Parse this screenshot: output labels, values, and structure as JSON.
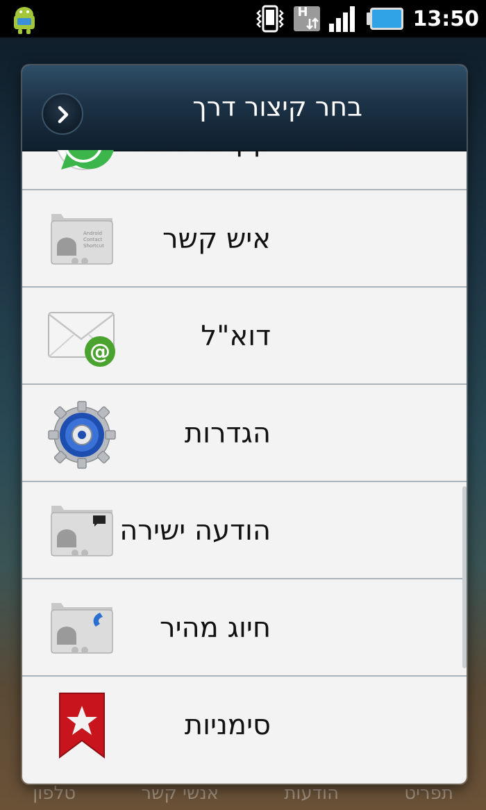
{
  "status_bar": {
    "time": "13:50",
    "network_label": "H",
    "icons": [
      "android-notification-icon",
      "vibrate-icon",
      "hspa-data-icon",
      "signal-icon",
      "battery-icon"
    ]
  },
  "dock": {
    "items": [
      "תפריט",
      "הודעות",
      "אנשי קשר",
      "טלפון"
    ]
  },
  "dialog": {
    "title": "בחר קיצור דרך",
    "items": [
      {
        "label": "WhatsApp",
        "icon": "whatsapp-icon"
      },
      {
        "label": "איש קשר",
        "icon": "contact-shortcut-icon"
      },
      {
        "label": "דוא\"ל",
        "icon": "email-icon"
      },
      {
        "label": "הגדרות",
        "icon": "settings-gear-icon"
      },
      {
        "label": "הודעה ישירה",
        "icon": "direct-message-icon"
      },
      {
        "label": "חיוג מהיר",
        "icon": "direct-dial-icon"
      },
      {
        "label": "סימניות",
        "icon": "bookmark-icon"
      }
    ],
    "shortcut_folder_text": [
      "Android",
      "Contact",
      "Shortcut"
    ]
  },
  "colors": {
    "header_top": "#2e4f68",
    "header_bottom": "#0f1f2d",
    "list_bg": "#f3f3f3",
    "divider": "#a9b3bb",
    "whatsapp_green": "#3cb54a",
    "bookmark_red": "#c8141c",
    "gear_blue": "#1e4fb0"
  }
}
